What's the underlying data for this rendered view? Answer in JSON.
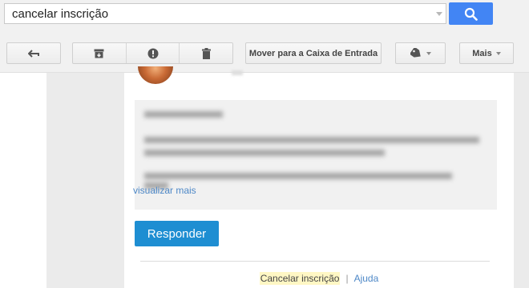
{
  "search": {
    "query": "cancelar inscrição"
  },
  "toolbar": {
    "move_to_inbox_label": "Mover para a Caixa de Entrada",
    "more_label": "Mais"
  },
  "message": {
    "view_more_label": "visualizar mais",
    "reply_label": "Responder"
  },
  "footer": {
    "unsubscribe_label": "Cancelar inscrição",
    "separator": "|",
    "help_label": "Ajuda"
  },
  "colors": {
    "search_button": "#4285f4",
    "reply_button": "#1e8ed2",
    "link": "#4e88c7",
    "highlight": "#fff7c4"
  }
}
